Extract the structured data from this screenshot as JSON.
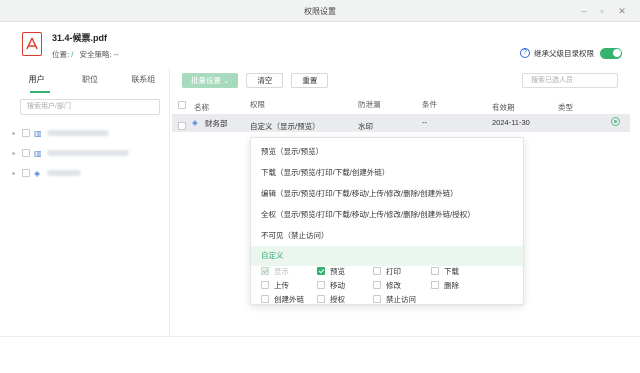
{
  "window": {
    "title": "权限设置"
  },
  "file": {
    "name": "31.4-候票.pdf",
    "location_label": "位置:",
    "location_value": "/",
    "policy_label": "安全策略:",
    "policy_value": "--",
    "inherit_label": "继承父级目录权限",
    "inherit_enabled": true
  },
  "left": {
    "tabs": [
      "用户",
      "职位",
      "联系组"
    ],
    "active_tab": "用户",
    "search_placeholder": "搜索用户/部门"
  },
  "toolbar": {
    "batch_label": "批量设置",
    "clear_label": "清空",
    "reset_label": "重置",
    "search_placeholder": "搜索已选人员"
  },
  "table": {
    "headers": {
      "name": "名称",
      "permission": "权限",
      "watermark": "防泄漏",
      "condition": "条件",
      "expires": "有效期",
      "type": "类型"
    },
    "rows": [
      {
        "name": "财务部",
        "permission": "自定义（显示/预览）",
        "watermark": "水印",
        "condition": "--",
        "expires": "2024-11-30"
      }
    ]
  },
  "dropdown": {
    "options": [
      "预览（显示/预览）",
      "下载（显示/预览/打印/下载/创建外链）",
      "编辑（显示/预览/打印/下载/移动/上传/修改/删除/创建外链）",
      "全权（显示/预览/打印/下载/移动/上传/修改/删除/创建外链/授权）",
      "不可见（禁止访问）",
      "自定义"
    ],
    "selected": "自定义",
    "perms": [
      {
        "label": "显示",
        "checked": true,
        "disabled": true
      },
      {
        "label": "预览",
        "checked": true,
        "disabled": false
      },
      {
        "label": "打印",
        "checked": false,
        "disabled": false
      },
      {
        "label": "下载",
        "checked": false,
        "disabled": false
      },
      {
        "label": "上传",
        "checked": false,
        "disabled": false
      },
      {
        "label": "移动",
        "checked": false,
        "disabled": false
      },
      {
        "label": "修改",
        "checked": false,
        "disabled": false
      },
      {
        "label": "删除",
        "checked": false,
        "disabled": false
      },
      {
        "label": "创建外链",
        "checked": false,
        "disabled": false
      },
      {
        "label": "授权",
        "checked": false,
        "disabled": false
      },
      {
        "label": "禁止访问",
        "checked": false,
        "disabled": false
      }
    ]
  },
  "colors": {
    "accent": "#35b26f",
    "pdf": "#e03b2f"
  }
}
